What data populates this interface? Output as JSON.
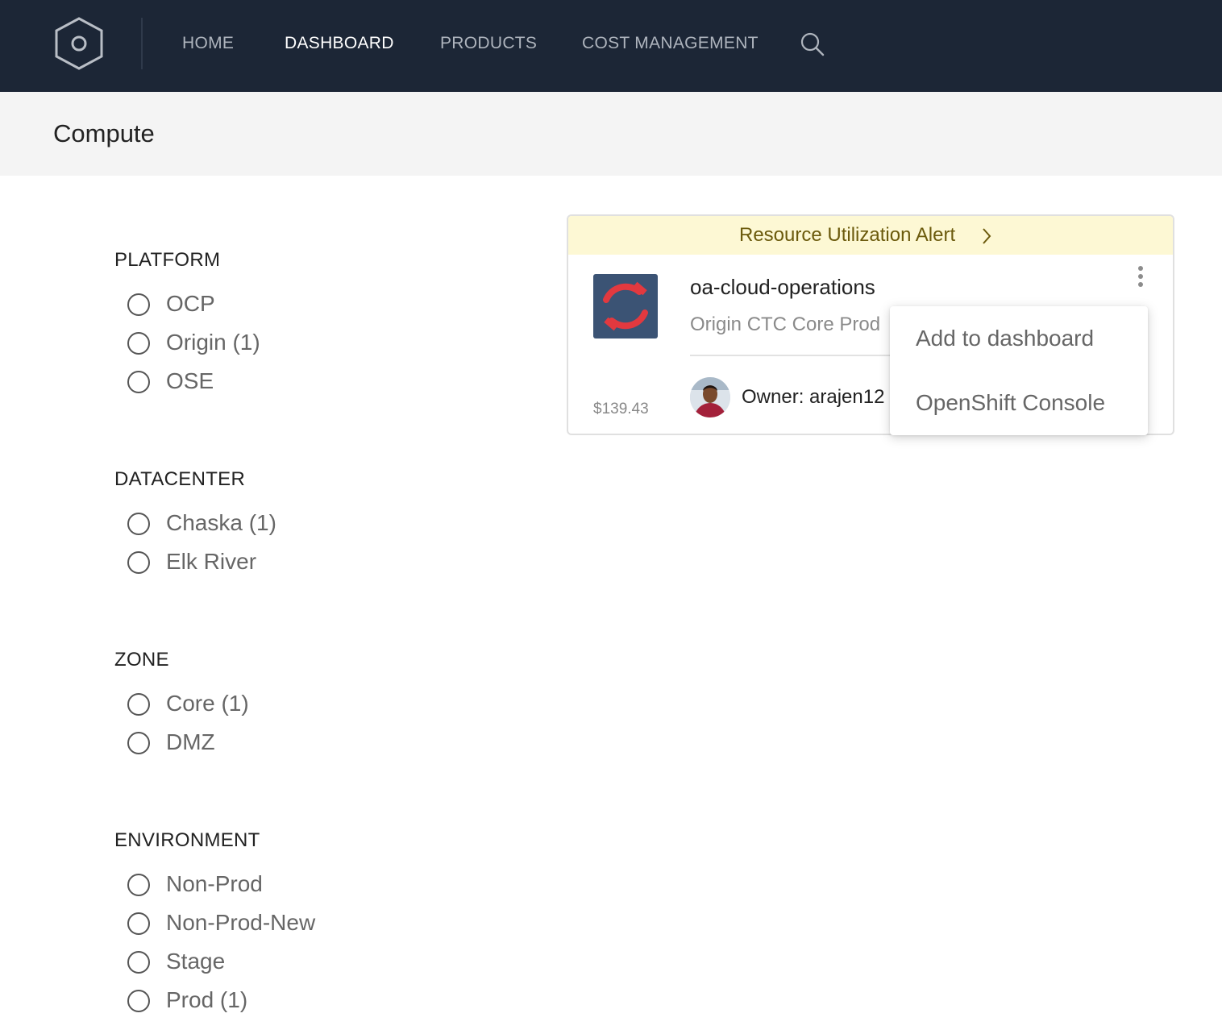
{
  "nav": {
    "items": [
      {
        "label": "HOME",
        "active": false
      },
      {
        "label": "DASHBOARD",
        "active": true
      },
      {
        "label": "PRODUCTS",
        "active": false
      },
      {
        "label": "COST MANAGEMENT",
        "active": false
      }
    ],
    "logo_icon": "hexagon-logo-icon",
    "search_icon": "search-icon"
  },
  "page": {
    "title": "Compute"
  },
  "filters": [
    {
      "title": "PLATFORM",
      "options": [
        "OCP",
        "Origin (1)",
        "OSE"
      ]
    },
    {
      "title": "DATACENTER",
      "options": [
        "Chaska (1)",
        "Elk River"
      ]
    },
    {
      "title": "ZONE",
      "options": [
        "Core (1)",
        "DMZ"
      ]
    },
    {
      "title": "ENVIRONMENT",
      "options": [
        "Non-Prod",
        "Non-Prod-New",
        "Stage",
        "Prod (1)"
      ]
    }
  ],
  "card": {
    "alert": "Resource Utilization Alert",
    "title": "oa-cloud-operations",
    "subtitle": "Origin CTC Core Prod",
    "cost": "$139.43",
    "owner": "Owner: arajen12",
    "app_icon": "openshift-origin-icon",
    "icon_bg": "#3b5374",
    "icon_color": "#e2393f"
  },
  "menu": {
    "items": [
      "Add to dashboard",
      "OpenShift Console"
    ]
  },
  "colors": {
    "nav_bg": "#1c2636",
    "header_bg": "#f4f4f4",
    "alert_bg": "#fdf8d4",
    "alert_text": "#6b5a0c"
  }
}
